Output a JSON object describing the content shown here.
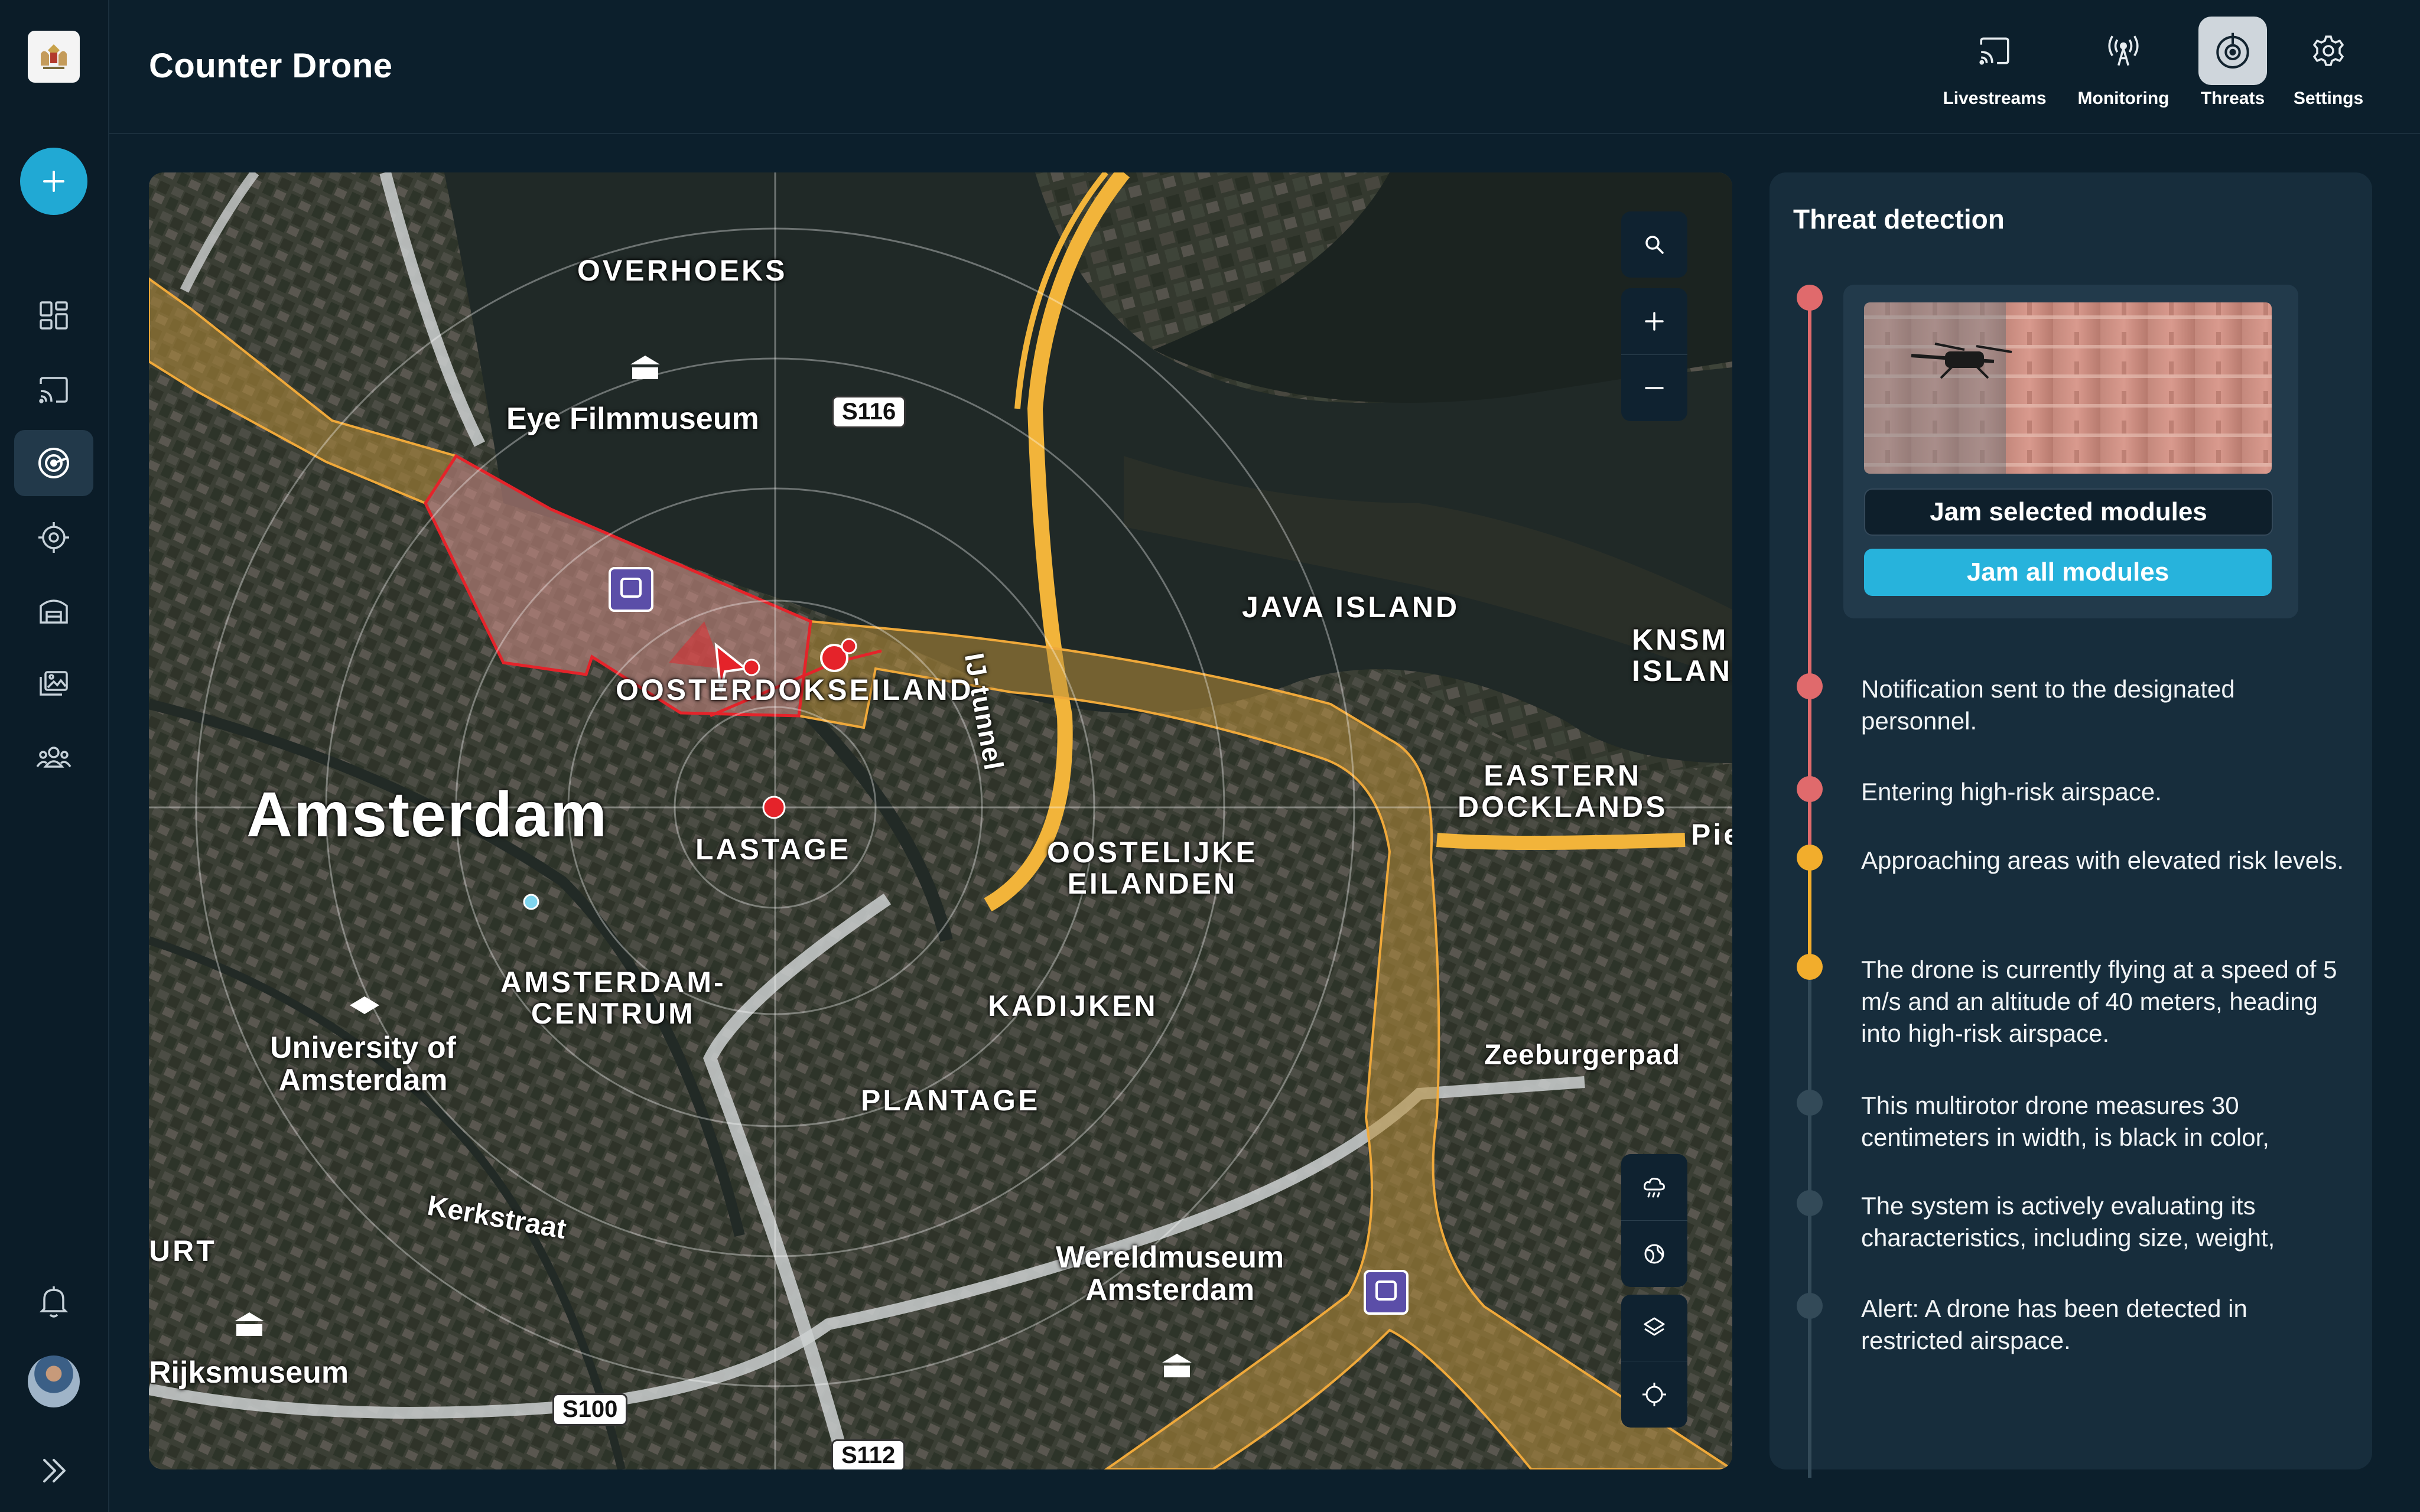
{
  "app": {
    "title": "Counter Drone"
  },
  "topnav": [
    {
      "label": "Livestreams",
      "icon": "cast-icon"
    },
    {
      "label": "Monitoring",
      "icon": "antenna-icon"
    },
    {
      "label": "Threats",
      "icon": "radar-target-icon",
      "active": true
    },
    {
      "label": "Settings",
      "icon": "gear-icon"
    }
  ],
  "sidebar": {
    "items": [
      "dashboard-icon",
      "cast-icon",
      "radar-icon",
      "target-icon",
      "building-icon",
      "gallery-icon",
      "team-icon"
    ],
    "active_item": "radar-icon"
  },
  "map": {
    "labels": {
      "overhoeks": "OVERHOEKS",
      "eye": "Eye Filmmuseum",
      "java": "JAVA ISLAND",
      "knsm": "KNSM\nISLAND",
      "oosterdok": "OOSTERDOKSEILAND",
      "amsterdam": "Amsterdam",
      "lastage": "LASTAGE",
      "oostelijke": "OOSTELIJKE\nEILANDEN",
      "eastern": "EASTERN\nDOCKLANDS",
      "pie": "Pie",
      "centrum": "AMSTERDAM-\nCENTRUM",
      "kadijken": "KADIJKEN",
      "plantage": "PLANTAGE",
      "zeeburgerpad": "Zeeburgerpad",
      "university": "University of\nAmsterdam",
      "kerkstraat": "Kerkstraat",
      "wereldmuseum": "Wereldmuseum\nAmsterdam",
      "rijksmuseum": "Rijksmuseum",
      "urt": "URT",
      "ijtunnel": "IJ-tunnel"
    },
    "road_badges": {
      "s116": "S116",
      "s100": "S100",
      "s112": "S112"
    },
    "controls": [
      "search-icon",
      "zoom-in-icon",
      "zoom-out-icon",
      "weather-icon",
      "globe-icon",
      "layers-icon",
      "locate-icon"
    ]
  },
  "threat_panel": {
    "title": "Threat detection",
    "jam_selected_label": "Jam selected modules",
    "jam_all_label": "Jam all modules",
    "events": [
      {
        "text": "Notification sent to the designated personnel.",
        "status": "red"
      },
      {
        "text": "Entering high-risk airspace.",
        "status": "red"
      },
      {
        "text": "Approaching areas with elevated risk levels.",
        "status": "amber"
      },
      {
        "text": "The drone is currently flying at a speed of 5 m/s and an altitude of 40 meters, heading into high-risk airspace.",
        "status": "amber"
      },
      {
        "text": "This multirotor drone measures 30 centimeters in width, is black in color,",
        "status": "grey"
      },
      {
        "text": "The system is actively evaluating its characteristics, including size, weight,",
        "status": "grey"
      },
      {
        "text": "Alert: A drone has been detected in restricted airspace.",
        "status": "grey"
      }
    ]
  },
  "colors": {
    "accent": "#27b3dc",
    "red": "#e06a6c",
    "amber": "#f2ad2c",
    "grey": "#334a58"
  }
}
